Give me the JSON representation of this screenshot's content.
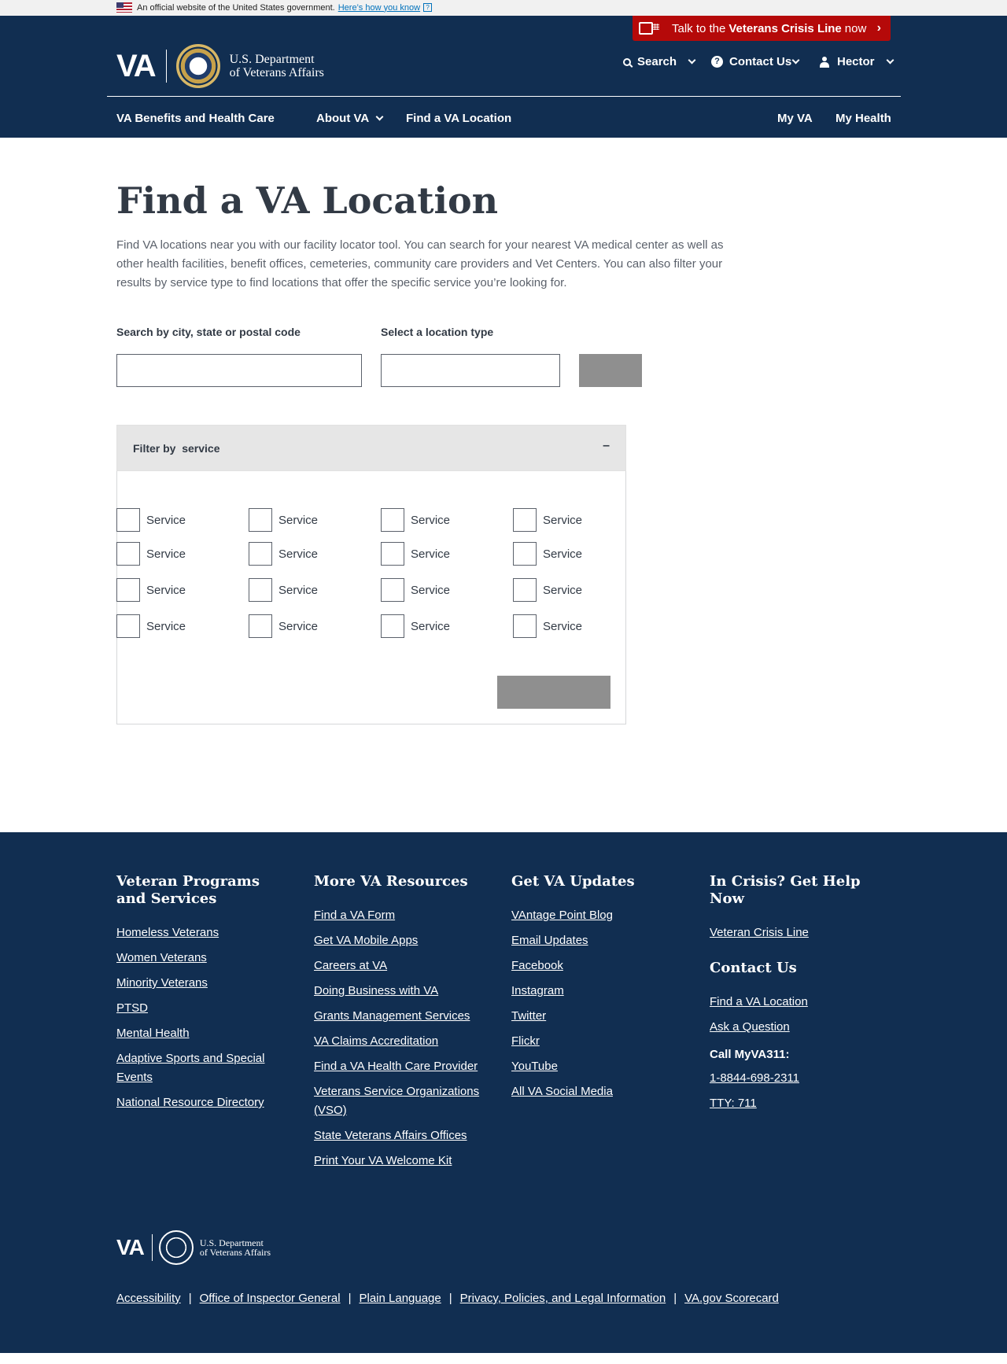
{
  "gov_banner": {
    "text": "An official website of the United States government.",
    "link": "Here’s how you know",
    "help_icon": "?"
  },
  "crisis": {
    "prefix": "Talk to the",
    "strong": "Veterans Crisis Line",
    "suffix": "now",
    "arrow_icon": "chevron-right-icon"
  },
  "header": {
    "logo_text": "VA",
    "dept_line1": "U.S. Department",
    "dept_line2": "of Veterans Affairs",
    "search": "Search",
    "contact": "Contact Us",
    "user": "Hector"
  },
  "nav": {
    "benefits": "VA Benefits and Health Care",
    "about": "About VA",
    "find": "Find a VA Location",
    "myva": "My VA",
    "myhealth": "My Health"
  },
  "main": {
    "title": "Find a VA Location",
    "intro": "Find VA locations near you with our facility locator tool. You can search for your nearest VA medical center as well as other health facilities, benefit offices, cemeteries, community care providers and Vet Centers. You can also filter your results by service type to find locations that offer the specific service you’re looking for.",
    "search_label": "Search by city, state or postal code",
    "search_value": "",
    "type_label": "Select a location type",
    "type_value": "",
    "filter_label": "Filter by  service",
    "filter_toggle": "–",
    "service_label": "Service"
  },
  "footer": {
    "col1": {
      "heading": "Veteran Programs and Services",
      "links": [
        "Homeless Veterans",
        "Women Veterans",
        "Minority Veterans",
        "PTSD",
        "Mental Health",
        "Adaptive Sports and Special Events",
        "National Resource Directory"
      ]
    },
    "col2": {
      "heading": "More VA Resources",
      "links": [
        "Find a VA Form",
        "Get VA Mobile Apps",
        "Careers at VA",
        "Doing Business with VA",
        "Grants Management Services",
        "VA Claims Accreditation",
        "Find a VA Health Care Provider",
        "Veterans Service Organizations (VSO)",
        "State Veterans Affairs Offices",
        "Print Your VA Welcome Kit"
      ]
    },
    "col3": {
      "heading": "Get VA Updates",
      "links": [
        "VAntage Point Blog",
        "Email Updates",
        "Facebook",
        "Instagram",
        "Twitter",
        "Flickr",
        "YouTube",
        "All VA Social Media"
      ]
    },
    "col4": {
      "heading": "In Crisis? Get Help Now",
      "crisis_link": "Veteran Crisis Line",
      "contact_heading": "Contact Us",
      "contact_links": [
        "Find a VA Location",
        "Ask a Question"
      ],
      "call_label": "Call MyVA311:",
      "phone": "1-8844-698-2311",
      "tty": "TTY: 711"
    },
    "logo_text": "VA",
    "dept_line1": "U.S. Department",
    "dept_line2": "of Veterans Affairs",
    "bottom_links": [
      "Accessibility",
      "Office of Inspector General",
      "Plain Language",
      "Privacy, Policies, and Legal Information",
      "VA.gov Scorecard"
    ],
    "separator": "|"
  },
  "colors": {
    "navy": "#112e51",
    "crisis_red": "#b50909",
    "link_blue": "#0071bb",
    "disabled_gray": "#8f8f8f"
  }
}
